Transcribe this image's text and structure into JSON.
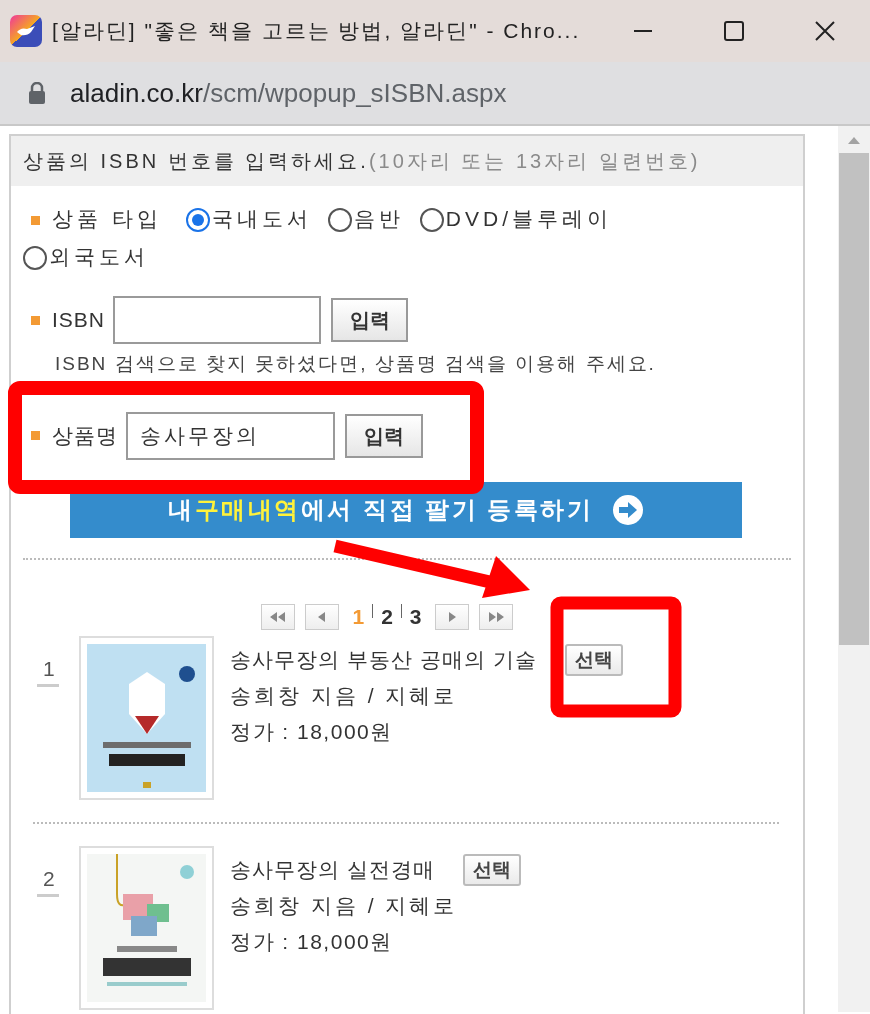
{
  "window": {
    "title": "[알라딘] \"좋은 책을 고르는 방법, 알라딘\" - Chro..."
  },
  "address_bar": {
    "domain": "aladin.co.kr",
    "path": "/scm/wpopup_sISBN.aspx"
  },
  "header": {
    "text": "상품의 ISBN 번호를 입력하세요.",
    "hint": "(10자리 또는 13자리 일련번호)"
  },
  "product_type": {
    "label": "상품 타입",
    "options": [
      {
        "label": "국내도서",
        "selected": true
      },
      {
        "label": "음반",
        "selected": false
      },
      {
        "label": "DVD/블루레이",
        "selected": false
      },
      {
        "label": "외국도서",
        "selected": false
      }
    ]
  },
  "isbn": {
    "label": "ISBN",
    "button": "입력",
    "note": "ISBN 검색으로 찾지 못하셨다면, 상품명 검색을 이용해 주세요."
  },
  "product_name": {
    "label": "상품명",
    "value": "송사무장의",
    "button": "입력"
  },
  "banner": {
    "segments": [
      {
        "text": "내 ",
        "highlight": false
      },
      {
        "text": "구매내역",
        "highlight": true
      },
      {
        "text": "에서 직접 팔기 등록하기",
        "highlight": false
      }
    ]
  },
  "pagination": {
    "pages": [
      {
        "label": "1",
        "selected": true
      },
      {
        "label": "2",
        "selected": false
      },
      {
        "label": "3",
        "selected": false
      }
    ]
  },
  "results": [
    {
      "number": "1",
      "title": "송사무장의 부동산 공매의 기술",
      "author": "송희창 지음 / 지혜로",
      "price": "정가 : 18,000원",
      "button": "선택"
    },
    {
      "number": "2",
      "title": "송사무장의 실전경매",
      "author": "송희창 지음 / 지혜로",
      "price": "정가 : 18,000원",
      "button": "선택"
    }
  ]
}
